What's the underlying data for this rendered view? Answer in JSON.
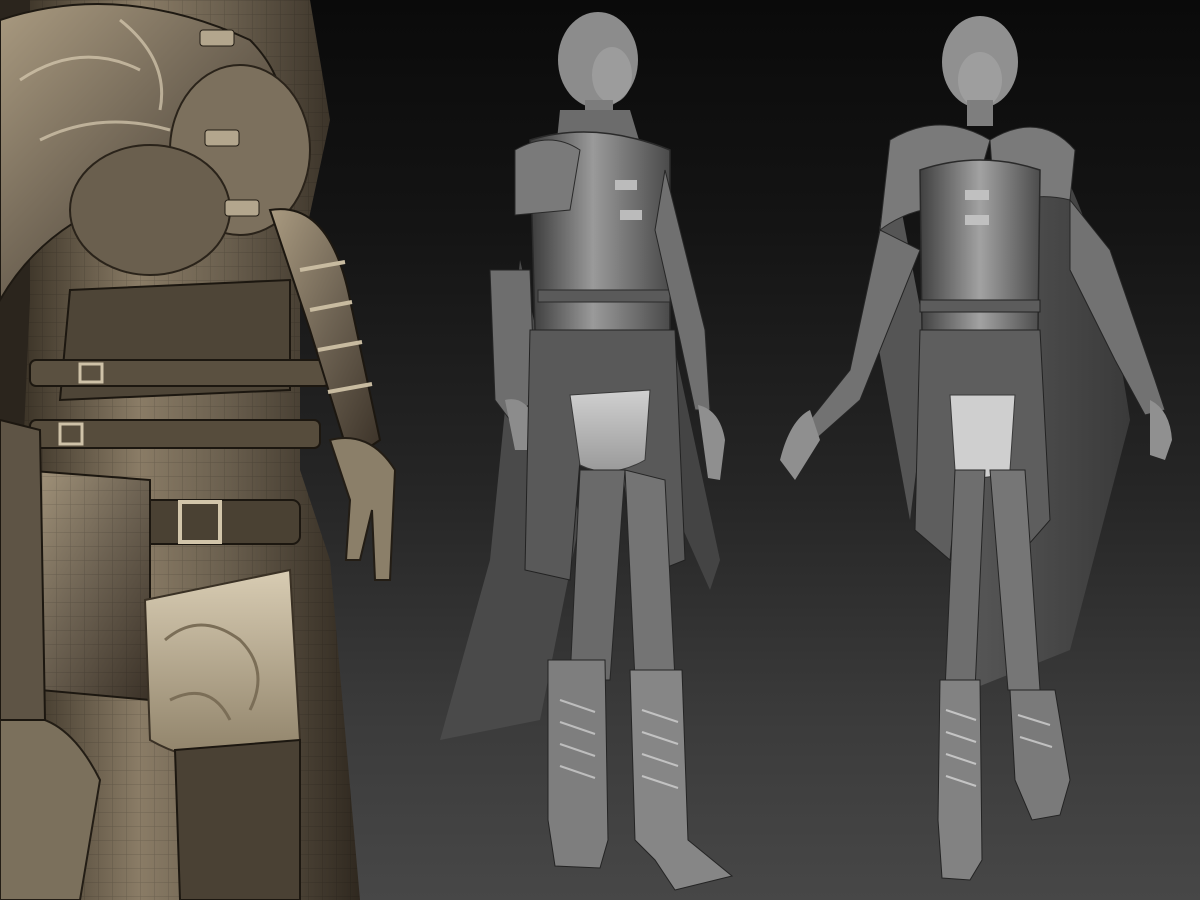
{
  "scene": {
    "background_top_color": "#0a0a0a",
    "background_bottom_color": "#474747",
    "views": [
      {
        "id": "closeup",
        "material": "bronze-clay",
        "base_color": "#6e6353",
        "highlight_color": "#c9bba2",
        "shadow_color": "#2a241c"
      },
      {
        "id": "front",
        "material": "grey-clay",
        "base_color": "#6a6a6a",
        "highlight_color": "#b8b8b8",
        "shadow_color": "#2c2c2c"
      },
      {
        "id": "three-quarter",
        "material": "grey-clay",
        "base_color": "#6e6e6e",
        "highlight_color": "#bdbdbd",
        "shadow_color": "#303030"
      }
    ]
  }
}
